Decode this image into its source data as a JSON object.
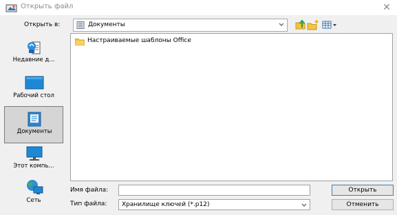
{
  "window": {
    "title": "Открыть файл",
    "close_symbol": "✕"
  },
  "look_in": {
    "label": "Открыть в:",
    "value": "Документы",
    "icon": "documents-folder-icon"
  },
  "toolbar": {
    "icons": [
      "up-folder-icon",
      "new-folder-icon",
      "view-menu-icon"
    ]
  },
  "places": [
    {
      "label": "Недавние д...",
      "icon": "recent-documents-icon"
    },
    {
      "label": "Рабочий стол",
      "icon": "desktop-icon"
    },
    {
      "label": "Документы",
      "icon": "documents-icon",
      "selected": true
    },
    {
      "label": "Этот компь...",
      "icon": "computer-icon"
    },
    {
      "label": "Сеть",
      "icon": "network-icon"
    }
  ],
  "files": [
    {
      "name": "Настраиваемые шаблоны Office",
      "icon": "folder-icon"
    }
  ],
  "file_name": {
    "label": "Имя файла:",
    "value": ""
  },
  "file_type": {
    "label": "Тип файла:",
    "value": "Хранилище ключей (*.p12)"
  },
  "buttons": {
    "open": "Открыть",
    "cancel": "Отменить"
  },
  "colors": {
    "folder": "#f5c242",
    "selection_bg": "#d5d5d5",
    "accent_border": "#3c7fb1"
  }
}
